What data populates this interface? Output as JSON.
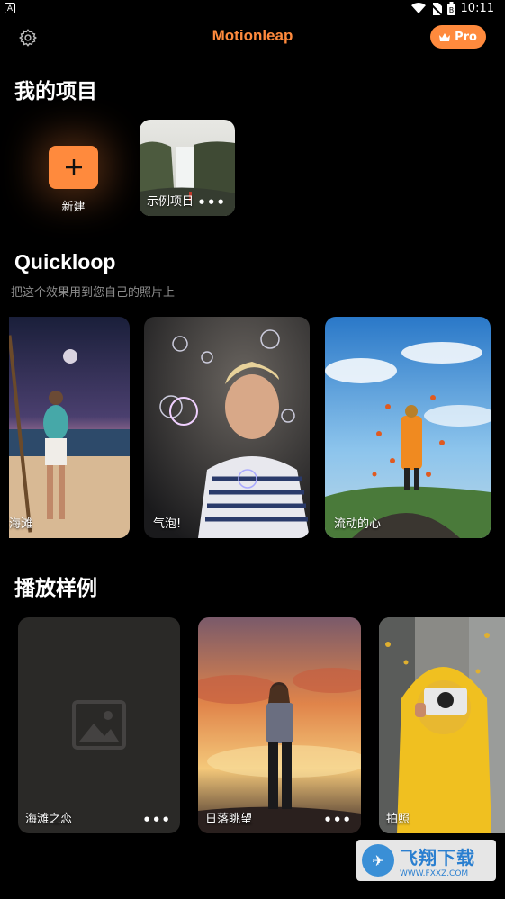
{
  "status": {
    "left_icon": "A",
    "time": "10:11",
    "battery_level": "B"
  },
  "header": {
    "title": "Motionleap",
    "pro_label": "Pro"
  },
  "my_projects": {
    "title": "我的项目",
    "new_label": "新建",
    "sample_label": "示例项目"
  },
  "quickloop": {
    "title": "Quickloop",
    "subtitle": "把这个效果用到您自己的照片上",
    "items": [
      {
        "label": "海滩"
      },
      {
        "label": "气泡!"
      },
      {
        "label": "流动的心"
      }
    ]
  },
  "showcase": {
    "title": "播放样例",
    "items": [
      {
        "label": "海滩之恋"
      },
      {
        "label": "日落眺望"
      },
      {
        "label": "拍照"
      }
    ]
  },
  "watermark": {
    "brand": "飞翔下载",
    "site": "WWW.FXXZ.COM"
  }
}
